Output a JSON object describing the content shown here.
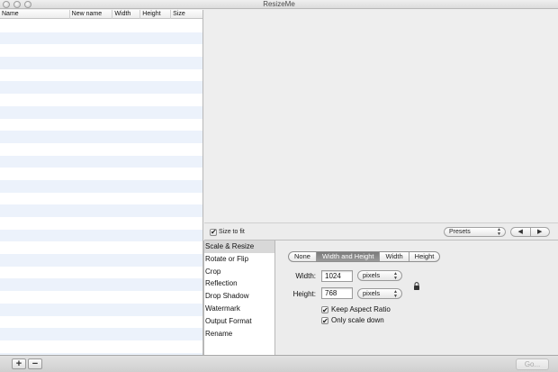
{
  "window": {
    "title": "ResizeMe"
  },
  "file_table": {
    "columns": [
      "Name",
      "New name",
      "Width",
      "Height",
      "Size"
    ]
  },
  "preview_toolbar": {
    "size_to_fit_label": "Size to fit",
    "size_to_fit_checked": true,
    "presets_label": "Presets",
    "prev_glyph": "◀",
    "next_glyph": "▶"
  },
  "sidebar": {
    "items": [
      "Scale & Resize",
      "Rotate or Flip",
      "Crop",
      "Reflection",
      "Drop Shadow",
      "Watermark",
      "Output Format",
      "Rename"
    ],
    "selected_index": 0
  },
  "scale_panel": {
    "mode_options": [
      "None",
      "Width and Height",
      "Width",
      "Height"
    ],
    "selected_mode": "Width and Height",
    "width_label": "Width:",
    "width_value": "1024",
    "width_unit": "pixels",
    "height_label": "Height:",
    "height_value": "768",
    "height_unit": "pixels",
    "keep_aspect_label": "Keep Aspect Ratio",
    "keep_aspect_checked": true,
    "only_scale_down_label": "Only scale down",
    "only_scale_down_checked": true
  },
  "bottom_bar": {
    "add_label": "+",
    "remove_label": "−",
    "go_label": "Go..."
  },
  "icons": [
    "close-icon",
    "minimize-icon",
    "zoom-icon",
    "lock-icon",
    "up-down-arrows-icon",
    "left-arrow-icon",
    "right-arrow-icon",
    "checkmark-icon"
  ]
}
